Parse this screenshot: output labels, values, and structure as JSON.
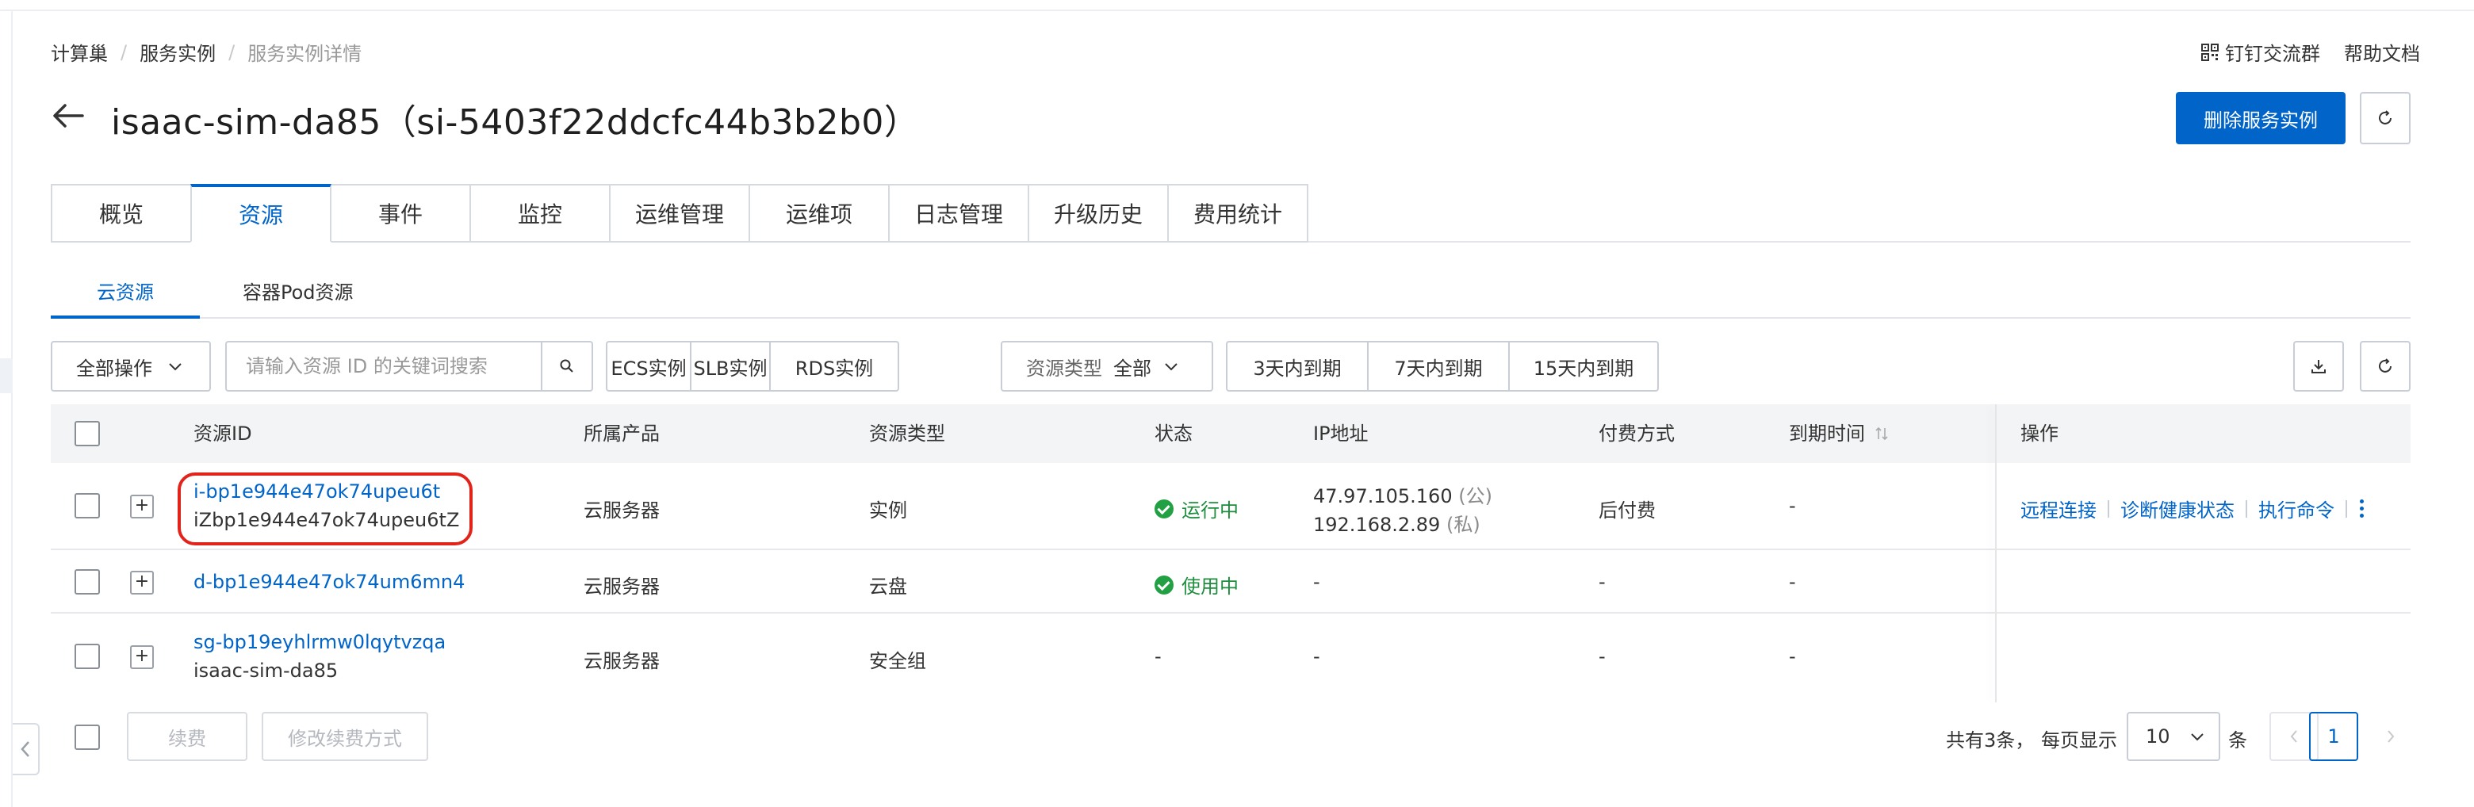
{
  "breadcrumb": {
    "items": [
      "计算巢",
      "服务实例",
      "服务实例详情"
    ],
    "separator": "/"
  },
  "top_links": {
    "dingtalk": "钉钉交流群",
    "help": "帮助文档"
  },
  "header": {
    "title": "isaac-sim-da85（si-5403f22ddcfc44b3b2b0）",
    "delete_button": "删除服务实例"
  },
  "main_tabs": [
    {
      "label": "概览"
    },
    {
      "label": "资源",
      "active": true
    },
    {
      "label": "事件"
    },
    {
      "label": "监控"
    },
    {
      "label": "运维管理"
    },
    {
      "label": "运维项"
    },
    {
      "label": "日志管理"
    },
    {
      "label": "升级历史"
    },
    {
      "label": "费用统计"
    }
  ],
  "sub_tabs": [
    {
      "label": "云资源",
      "active": true
    },
    {
      "label": "容器Pod资源"
    }
  ],
  "toolbar": {
    "bulk_action": "全部操作",
    "search_placeholder": "请输入资源 ID 的关键词搜索",
    "type_filters": [
      "ECS实例",
      "SLB实例",
      "RDS实例"
    ],
    "resource_type_label": "资源类型",
    "resource_type_value": "全部",
    "expiry_filters": [
      "3天内到期",
      "7天内到期",
      "15天内到期"
    ]
  },
  "table": {
    "columns": [
      "资源ID",
      "所属产品",
      "资源类型",
      "状态",
      "IP地址",
      "付费方式",
      "到期时间",
      "操作"
    ],
    "rows": [
      {
        "id": "i-bp1e944e47ok74upeu6t",
        "sub": "iZbp1e944e47ok74upeu6tZ",
        "product": "云服务器",
        "type": "实例",
        "status": "运行中",
        "ip_public": "47.97.105.160",
        "ip_public_tag": "(公)",
        "ip_private": "192.168.2.89",
        "ip_private_tag": "(私)",
        "billing": "后付费",
        "expire": "-",
        "ops": [
          "远程连接",
          "诊断健康状态",
          "执行命令"
        ]
      },
      {
        "id": "d-bp1e944e47ok74um6mn4",
        "product": "云服务器",
        "type": "云盘",
        "status": "使用中",
        "ip": "-",
        "billing": "-",
        "expire": "-"
      },
      {
        "id": "sg-bp19eyhlrmw0lqytvzqa",
        "sub": "isaac-sim-da85",
        "product": "云服务器",
        "type": "安全组",
        "status": "-",
        "ip": "-",
        "billing": "-",
        "expire": "-"
      }
    ]
  },
  "footer": {
    "renew": "续费",
    "modify_renew": "修改续费方式",
    "total": "共有3条，",
    "per_page": "每页显示",
    "page_size": "10",
    "unit": "条",
    "current_page": "1"
  },
  "colors": {
    "primary": "#0064c8",
    "success": "#23a043",
    "highlight": "#e2231a"
  }
}
